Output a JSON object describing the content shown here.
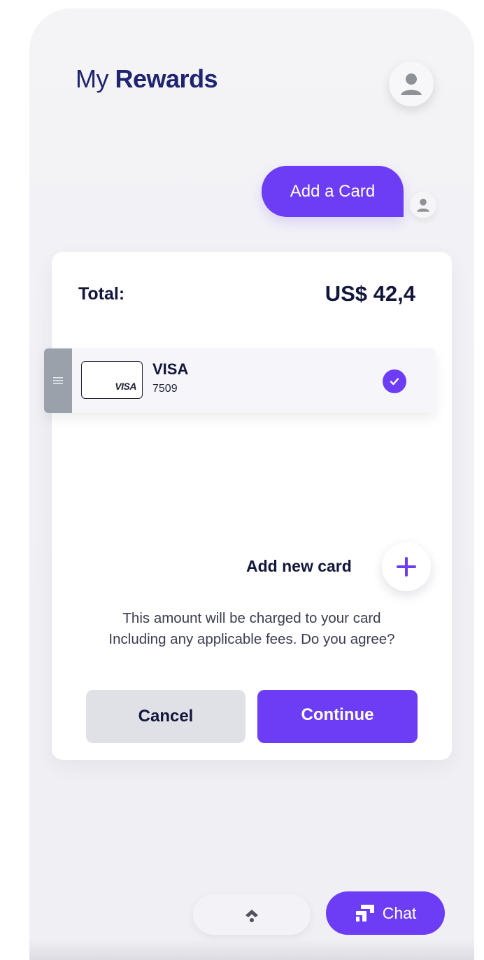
{
  "header": {
    "title_light": "My",
    "title_bold": "Rewards"
  },
  "chat_bubble": {
    "label": "Add a Card"
  },
  "checkout": {
    "total_label": "Total:",
    "total_amount": "US$ 42,4",
    "saved_card": {
      "logo_text": "VISA",
      "brand": "VISA",
      "last4": "7509",
      "selected": true
    },
    "add_new_card_label": "Add new card",
    "notice_line1": "This amount will be charged to your card",
    "notice_line2": "Including any applicable fees. Do you agree?",
    "cancel_label": "Cancel",
    "continue_label": "Continue"
  },
  "bottom_bar": {
    "chat_label": "Chat"
  },
  "colors": {
    "accent": "#6c3df5",
    "title": "#1f2470",
    "text_dark": "#12163b",
    "cancel_bg": "#dfe1e6",
    "handle_gray": "#9aa1ab"
  },
  "icons": {
    "profile": "user-avatar-icon",
    "drag": "drag-handle-icon",
    "check": "check-circle-icon",
    "add": "plus-icon",
    "scroll_up": "chevron-up-icon",
    "chat": "chat-bubbles-icon"
  }
}
